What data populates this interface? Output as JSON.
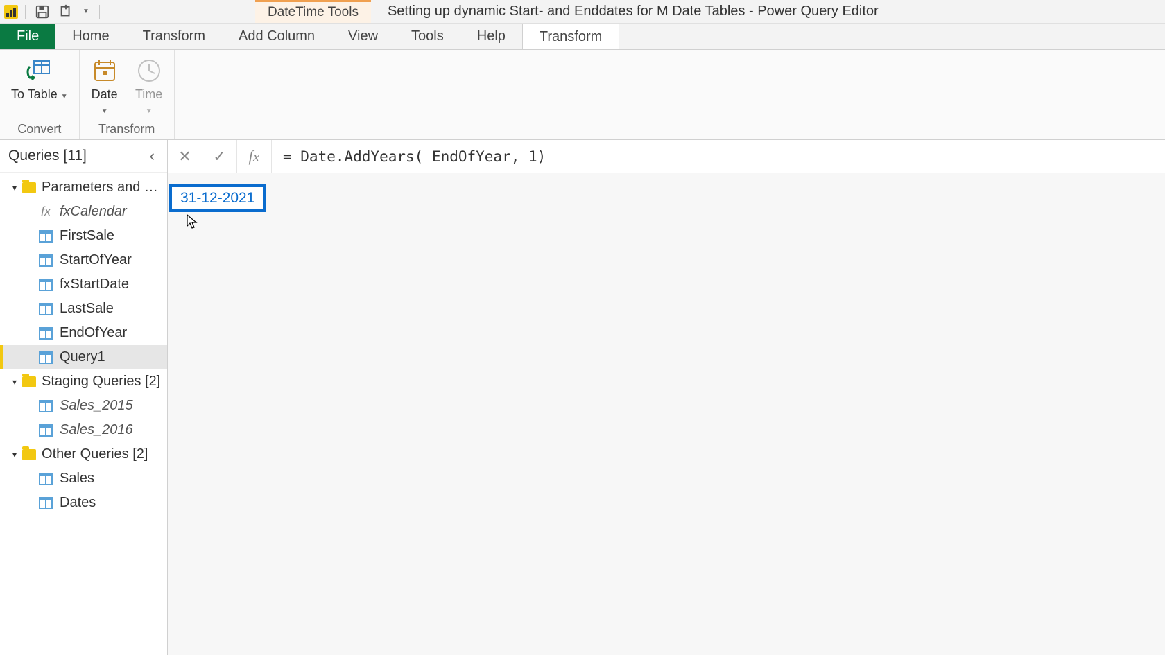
{
  "titlebar": {
    "context_group_label": "DateTime Tools",
    "window_title": "Setting up dynamic Start- and Enddates for M Date Tables - Power Query Editor"
  },
  "tabs": {
    "file": "File",
    "list": [
      "Home",
      "Transform",
      "Add Column",
      "View",
      "Tools",
      "Help"
    ],
    "context": "Transform"
  },
  "ribbon": {
    "groups": [
      {
        "label": "Convert",
        "buttons": [
          {
            "id": "to-table",
            "label": "To\nTable",
            "dropdown": true
          }
        ]
      },
      {
        "label": "Transform",
        "buttons": [
          {
            "id": "date",
            "label": "Date",
            "dropdown": true
          },
          {
            "id": "time",
            "label": "Time",
            "dropdown": true,
            "disabled": true
          }
        ]
      }
    ]
  },
  "queries": {
    "header": "Queries [11]",
    "groups": [
      {
        "label": "Parameters and Fu…",
        "items": [
          {
            "id": "fxcalendar",
            "label": "fxCalendar",
            "icon": "fx",
            "italic": true
          },
          {
            "id": "firstsale",
            "label": "FirstSale",
            "icon": "table"
          },
          {
            "id": "startofyear",
            "label": "StartOfYear",
            "icon": "table"
          },
          {
            "id": "fxstartdate",
            "label": "fxStartDate",
            "icon": "table"
          },
          {
            "id": "lastsale",
            "label": "LastSale",
            "icon": "table"
          },
          {
            "id": "endofyear",
            "label": "EndOfYear",
            "icon": "table"
          },
          {
            "id": "query1",
            "label": "Query1",
            "icon": "table",
            "selected": true
          }
        ]
      },
      {
        "label": "Staging Queries [2]",
        "items": [
          {
            "id": "sales2015",
            "label": "Sales_2015",
            "icon": "table",
            "italic": true
          },
          {
            "id": "sales2016",
            "label": "Sales_2016",
            "icon": "table",
            "italic": true
          }
        ]
      },
      {
        "label": "Other Queries [2]",
        "items": [
          {
            "id": "sales",
            "label": "Sales",
            "icon": "table"
          },
          {
            "id": "dates",
            "label": "Dates",
            "icon": "table"
          }
        ]
      }
    ]
  },
  "formula": {
    "text": "= Date.AddYears( EndOfYear, 1)"
  },
  "result": {
    "value": "31-12-2021"
  }
}
